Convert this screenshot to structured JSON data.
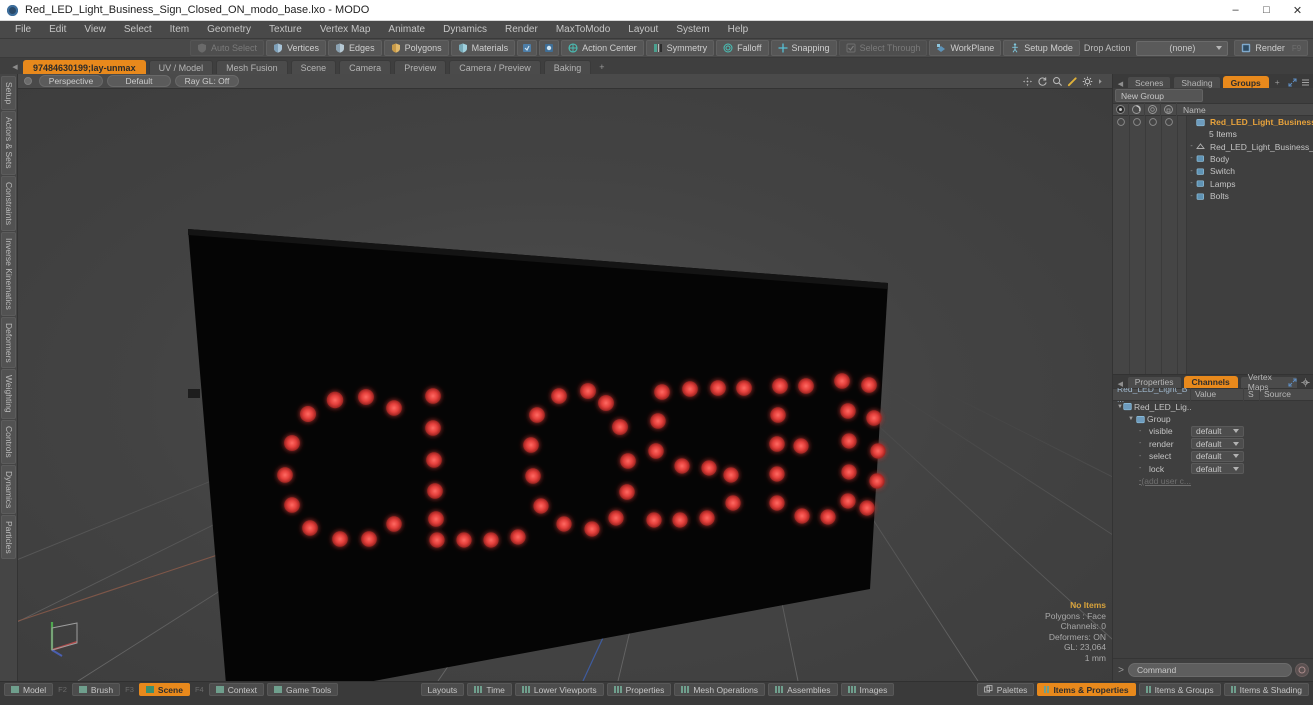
{
  "window": {
    "title": "Red_LED_Light_Business_Sign_Closed_ON_modo_base.lxo - MODO",
    "minimize": "–",
    "maximize": "□",
    "close": "✕"
  },
  "menubar": {
    "items": [
      "File",
      "Edit",
      "View",
      "Select",
      "Item",
      "Geometry",
      "Texture",
      "Vertex Map",
      "Animate",
      "Dynamics",
      "Render",
      "MaxToModo",
      "Layout",
      "System",
      "Help"
    ]
  },
  "toolbar": {
    "auto_select": "Auto Select",
    "vertices": "Vertices",
    "edges": "Edges",
    "polygons": "Polygons",
    "materials": "Materials",
    "action_center": "Action Center",
    "symmetry": "Symmetry",
    "falloff": "Falloff",
    "snapping": "Snapping",
    "select_through": "Select Through",
    "workplane": "WorkPlane",
    "setup_mode": "Setup Mode",
    "drop_action_label": "Drop Action",
    "drop_action_value": "(none)",
    "render": "Render",
    "render_key": "F9"
  },
  "tabstrip": {
    "tabs": [
      {
        "label": "97484630199;lay-unmax",
        "active": true
      },
      {
        "label": "UV / Model",
        "active": false
      },
      {
        "label": "Mesh Fusion",
        "active": false
      },
      {
        "label": "Scene",
        "active": false
      },
      {
        "label": "Camera",
        "active": false
      },
      {
        "label": "Preview",
        "active": false
      },
      {
        "label": "Camera / Preview",
        "active": false
      },
      {
        "label": "Baking",
        "active": false
      }
    ],
    "add": "+"
  },
  "left_sidebar": {
    "items": [
      "Setup",
      "Actors & Sets",
      "Constraints",
      "Inverse Kinematics",
      "Deformers",
      "Weighting",
      "Controls",
      "Dynamics",
      "Particles"
    ]
  },
  "viewport": {
    "perspective": "Perspective",
    "shading": "Default",
    "raygl": "Ray GL: Off",
    "status": {
      "items": "No Items",
      "polygons": "Polygons : Face",
      "channels": "Channels: 0",
      "deformers": "Deformers: ON",
      "gl": "GL: 23,064",
      "unit": "1 mm"
    },
    "led_color": "#e5403c",
    "sign_color": "#050505",
    "text": "CLOSED"
  },
  "right_panel": {
    "tabs": [
      {
        "label": "Scenes",
        "active": false
      },
      {
        "label": "Shading",
        "active": false
      },
      {
        "label": "Groups",
        "active": true
      }
    ],
    "add": "+",
    "new_group": "New Group",
    "tree_header_name": "Name",
    "tree": [
      {
        "label": "Red_LED_Light_Business ...",
        "type": "group",
        "indent": 0,
        "selected": true
      },
      {
        "label": "5 Items",
        "type": "count",
        "indent": 1,
        "selected": false
      },
      {
        "label": "Red_LED_Light_Business_S...",
        "type": "mesh",
        "indent": 1,
        "selected": false
      },
      {
        "label": "Body",
        "type": "item",
        "indent": 1,
        "selected": false
      },
      {
        "label": "Switch",
        "type": "item",
        "indent": 1,
        "selected": false
      },
      {
        "label": "Lamps",
        "type": "item",
        "indent": 1,
        "selected": false
      },
      {
        "label": "Bolts",
        "type": "item",
        "indent": 1,
        "selected": false
      }
    ]
  },
  "channels_panel": {
    "tabs": [
      {
        "label": "Properties",
        "active": false
      },
      {
        "label": "Channels",
        "active": true
      },
      {
        "label": "Vertex Maps",
        "active": false
      }
    ],
    "add": "+",
    "columns": [
      "Red_LED_Light_B ...",
      "Value",
      "S",
      "Source"
    ],
    "rows": [
      {
        "name": "Red_LED_Lig...",
        "value": "",
        "indent": 0,
        "type": "root"
      },
      {
        "name": "Group",
        "value": "",
        "indent": 1,
        "type": "group"
      },
      {
        "name": "visible",
        "value": "default",
        "indent": 2,
        "type": "channel"
      },
      {
        "name": "render",
        "value": "default",
        "indent": 2,
        "type": "channel"
      },
      {
        "name": "select",
        "value": "default",
        "indent": 2,
        "type": "channel"
      },
      {
        "name": "lock",
        "value": "default",
        "indent": 2,
        "type": "channel"
      },
      {
        "name": "(add user c...",
        "value": "",
        "indent": 2,
        "type": "adduser"
      }
    ],
    "command_placeholder": "Command"
  },
  "bottombar": {
    "left": [
      {
        "label": "Model",
        "key": "F2",
        "active": false
      },
      {
        "label": "Brush",
        "key": "F3",
        "active": false
      },
      {
        "label": "Scene",
        "key": "F4",
        "active": true
      },
      {
        "label": "Context",
        "key": "",
        "active": false
      },
      {
        "label": "Game Tools",
        "key": "",
        "active": false
      }
    ],
    "center": [
      {
        "label": "Layouts",
        "icon": false
      },
      {
        "label": "Time",
        "icon": true
      },
      {
        "label": "Lower Viewports",
        "icon": true
      },
      {
        "label": "Properties",
        "icon": true
      },
      {
        "label": "Mesh Operations",
        "icon": true
      },
      {
        "label": "Assemblies",
        "icon": true
      },
      {
        "label": "Images",
        "icon": true
      }
    ],
    "right": [
      {
        "label": "Palettes",
        "active": false
      },
      {
        "label": "Items & Properties",
        "active": true
      },
      {
        "label": "Items & Groups",
        "active": false
      },
      {
        "label": "Items & Shading",
        "active": false
      }
    ]
  }
}
